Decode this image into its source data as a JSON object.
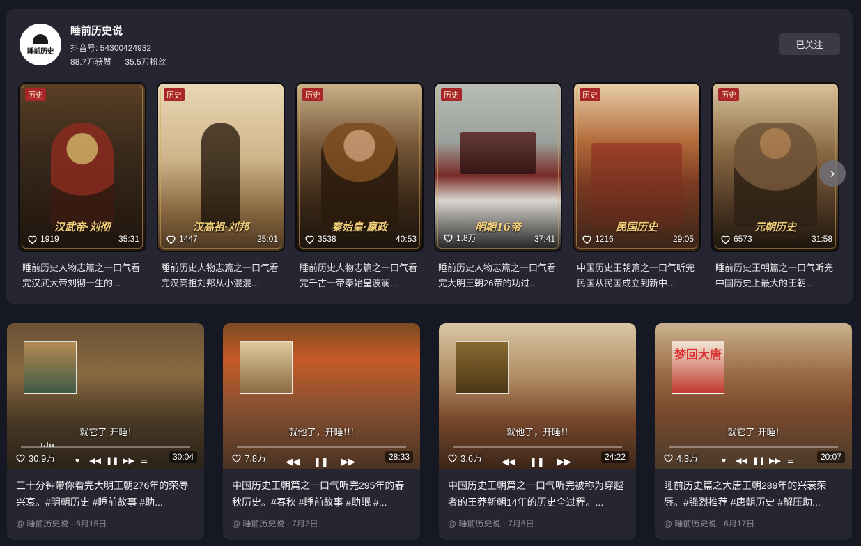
{
  "profile": {
    "name": "睡前历史说",
    "account_id": "抖音号: 54300424932",
    "likes": "88.7万获赞",
    "fans": "35.5万粉丝",
    "follow_label": "已关注",
    "avatar_text": "睡前历史"
  },
  "collections": [
    {
      "tag": "历史",
      "cover_title": "汉武帝·刘彻",
      "likes": "1919",
      "duration": "35:31",
      "title": "睡前历史人物志篇之一口气看完汉武大帝刘彻一生的..."
    },
    {
      "tag": "历史",
      "cover_title": "汉高祖·刘邦",
      "likes": "1447",
      "duration": "25:01",
      "title": "睡前历史人物志篇之一口气看完汉高祖刘邦从小混混..."
    },
    {
      "tag": "历史",
      "cover_title": "秦始皇·嬴政",
      "likes": "3538",
      "duration": "40:53",
      "title": "睡前历史人物志篇之一口气看完千古一帝秦始皇波澜..."
    },
    {
      "tag": "历史",
      "cover_title": "明朝16帝",
      "likes": "1.8万",
      "duration": "37:41",
      "title": "睡前历史人物志篇之一口气看完大明王朝26帝的功过..."
    },
    {
      "tag": "历史",
      "cover_title": "民国历史",
      "likes": "1216",
      "duration": "29:05",
      "title": "中国历史王朝篇之一口气听完民国从民国成立到新中..."
    },
    {
      "tag": "历史",
      "cover_title": "元朝历史",
      "likes": "6573",
      "duration": "31:58",
      "title": "睡前历史王朝篇之一口气听完中国历史上最大的王朝..."
    }
  ],
  "next_arrow": "›",
  "videos": [
    {
      "likes": "30.9万",
      "duration": "30:04",
      "lyric": "就它了 开睡!",
      "art_title": "",
      "desc": "三十分钟带你看完大明王朝276年的荣辱兴衰。#明朝历史 #睡前故事 #助...",
      "meta": "@ 睡前历史说 · 6月15日"
    },
    {
      "likes": "7.8万",
      "duration": "28:33",
      "lyric": "就他了，开睡!!!",
      "art_title": "",
      "desc": "中国历史王朝篇之一口气听完295年的春秋历史。#春秋 #睡前故事 #助眠 #...",
      "meta": "@ 睡前历史说 · 7月2日"
    },
    {
      "likes": "3.6万",
      "duration": "24:22",
      "lyric": "就他了，开睡!!",
      "art_title": "",
      "desc": "中国历史王朝篇之一口气听完被称为穿越者的王莽新朝14年的历史全过程。...",
      "meta": "@ 睡前历史说 · 7月6日"
    },
    {
      "likes": "4.3万",
      "duration": "20:07",
      "lyric": "就它了 开睡!",
      "art_title": "梦回大唐",
      "desc": "睡前历史篇之大唐王朝289年的兴衰荣辱。#强烈推荐 #唐朝历史 #解压助...",
      "meta": "@ 睡前历史说 · 6月17日"
    }
  ],
  "controls": {
    "heart": "♥",
    "prev": "◀◀",
    "pause": "❚❚",
    "next": "▶▶",
    "list": "☰"
  },
  "colors": {
    "background": "#161823",
    "card": "#252632",
    "badge": "#a8262a",
    "gold_title": "#f3cf7a"
  }
}
